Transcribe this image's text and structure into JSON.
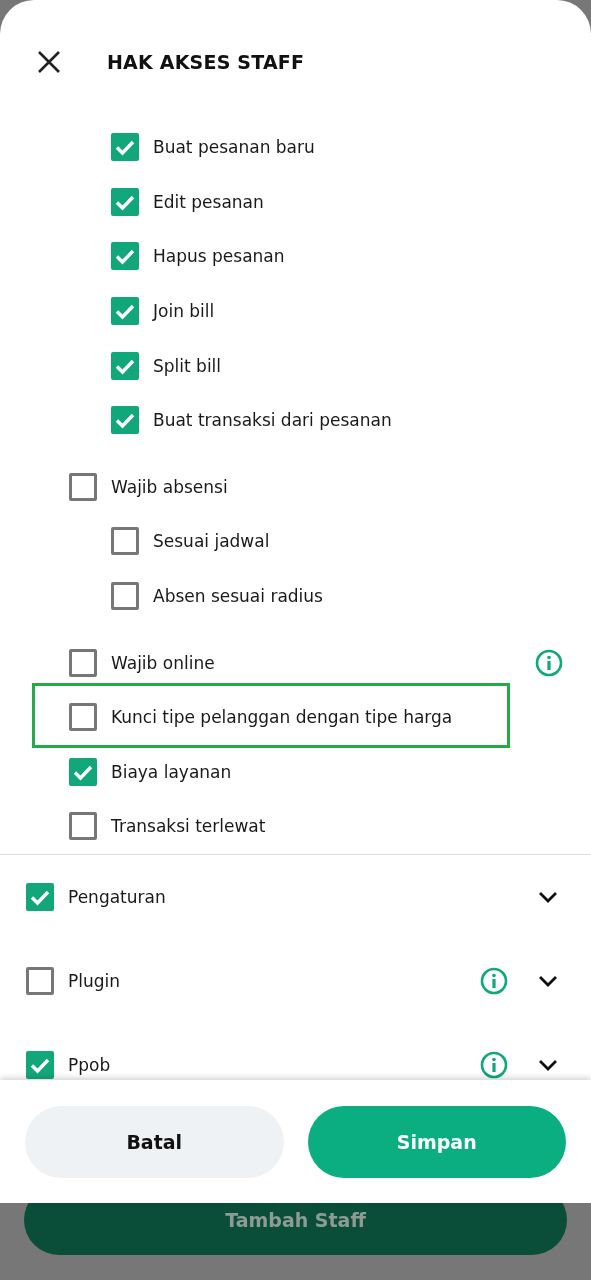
{
  "header": {
    "title": "HAK AKSES STAFF"
  },
  "sub_items": [
    {
      "label": "Buat pesanan baru",
      "checked": true
    },
    {
      "label": "Edit pesanan",
      "checked": true
    },
    {
      "label": "Hapus pesanan",
      "checked": true
    },
    {
      "label": "Join bill",
      "checked": true
    },
    {
      "label": "Split bill",
      "checked": true
    },
    {
      "label": "Buat transaksi dari pesanan",
      "checked": true
    }
  ],
  "items": [
    {
      "label": "Wajib absensi",
      "checked": false,
      "info": false,
      "highlighted": false,
      "children": [
        {
          "label": "Sesuai jadwal",
          "checked": false
        },
        {
          "label": "Absen sesuai radius",
          "checked": false
        }
      ]
    },
    {
      "label": "Wajib online",
      "checked": false,
      "info": true,
      "highlighted": false
    },
    {
      "label": "Kunci tipe pelanggan dengan tipe harga",
      "checked": false,
      "info": false,
      "highlighted": true
    },
    {
      "label": "Biaya layanan",
      "checked": true,
      "info": false,
      "highlighted": false
    },
    {
      "label": "Transaksi terlewat",
      "checked": false,
      "info": false,
      "highlighted": false
    }
  ],
  "groups": [
    {
      "label": "Pengaturan",
      "checked": true,
      "info": false,
      "expanded": false
    },
    {
      "label": "Plugin",
      "checked": false,
      "info": true,
      "expanded": false
    },
    {
      "label": "Ppob",
      "checked": true,
      "info": true,
      "expanded": false
    }
  ],
  "footer": {
    "buttons": [
      {
        "label": "Batal",
        "kind": "secondary"
      },
      {
        "label": "Simpan",
        "kind": "primary"
      }
    ]
  },
  "background": {
    "button": "Tambah Staff"
  }
}
